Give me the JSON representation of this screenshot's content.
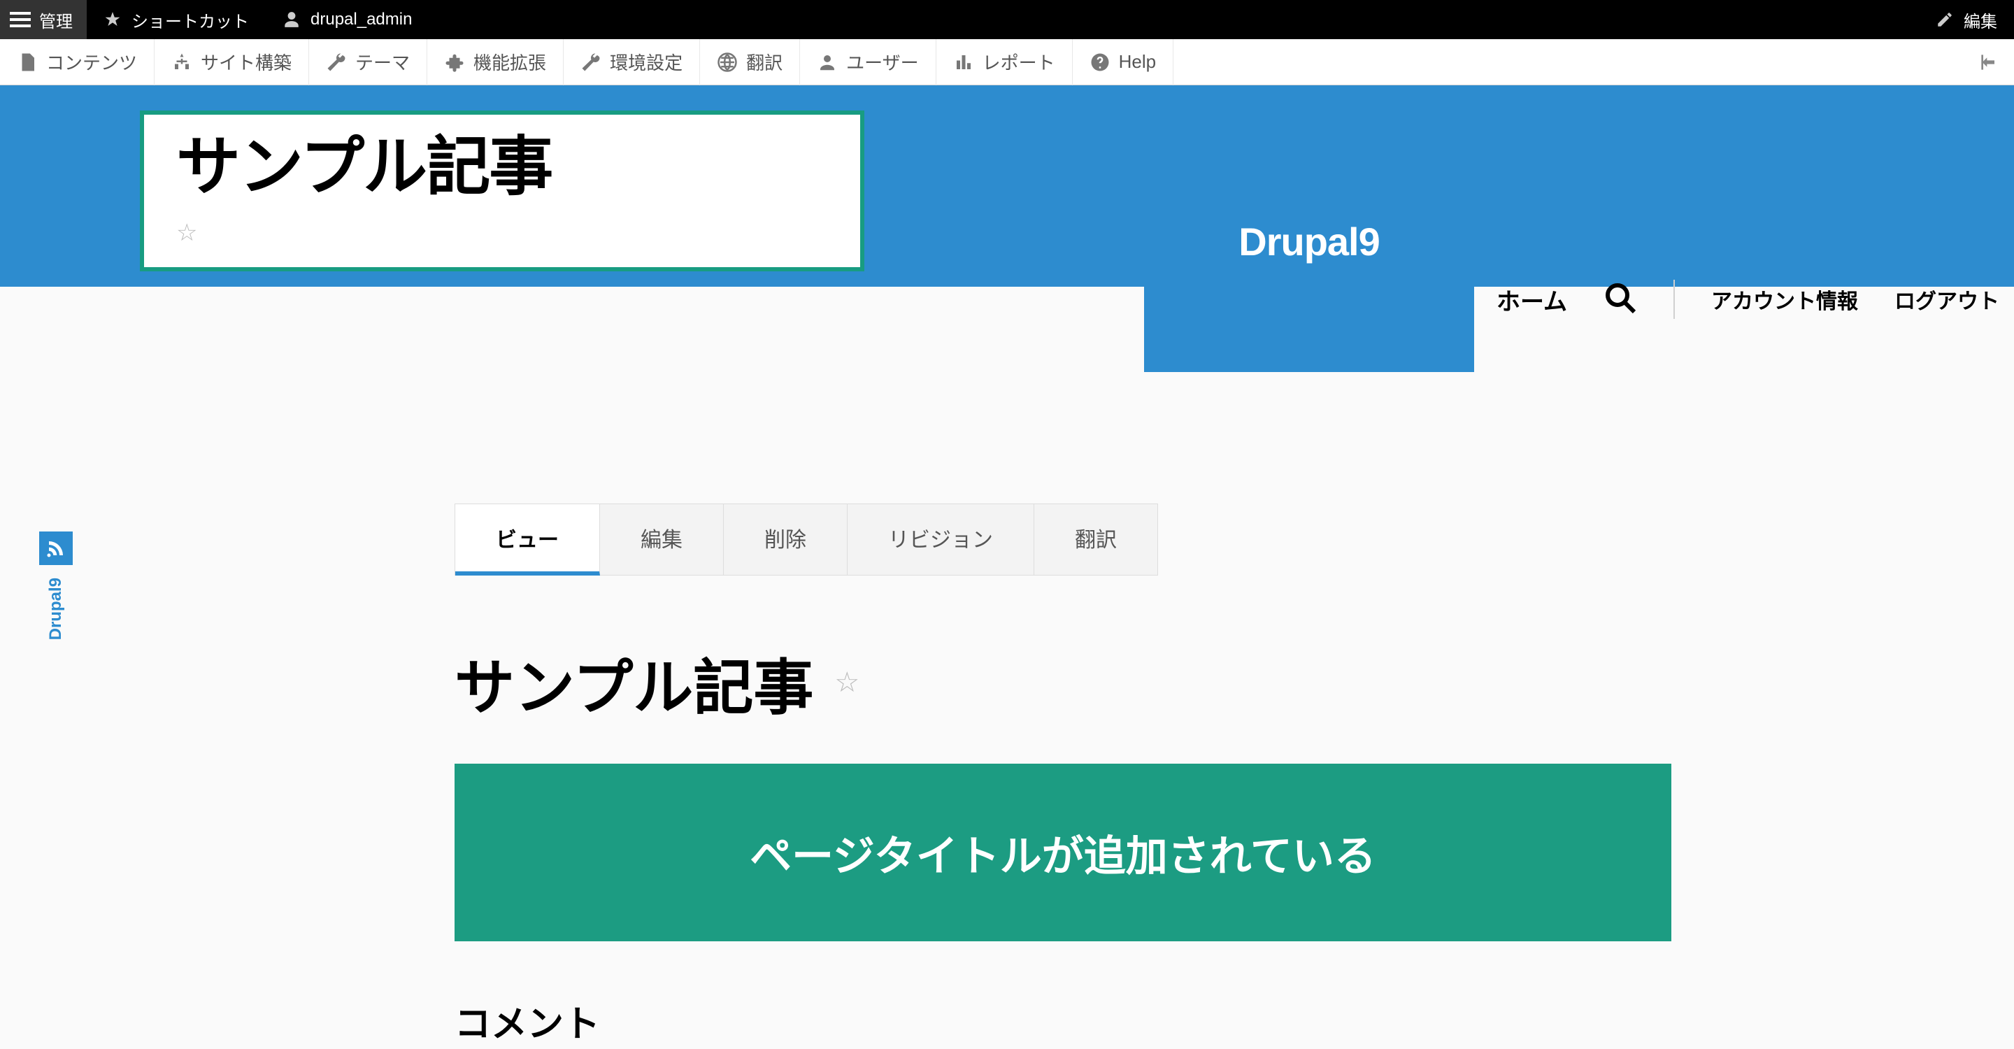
{
  "topbar": {
    "manage": "管理",
    "shortcuts": "ショートカット",
    "user": "drupal_admin",
    "edit": "編集"
  },
  "admin_menu": {
    "content": "コンテンツ",
    "structure": "サイト構築",
    "appearance": "テーマ",
    "extend": "機能拡張",
    "configuration": "環境設定",
    "translate": "翻訳",
    "people": "ユーザー",
    "reports": "レポート",
    "help": "Help"
  },
  "callout_title": "サンプル記事",
  "brand": "Drupal9",
  "nav": {
    "home": "ホーム",
    "account": "アカウント情報",
    "logout": "ログアウト"
  },
  "side_label": "Drupal9",
  "tabs": {
    "view": "ビュー",
    "edit": "編集",
    "delete": "削除",
    "revisions": "リビジョン",
    "translate": "翻訳"
  },
  "article": {
    "title": "サンプル記事",
    "banner": "ページタイトルが追加されている",
    "comments_heading": "コメント"
  }
}
